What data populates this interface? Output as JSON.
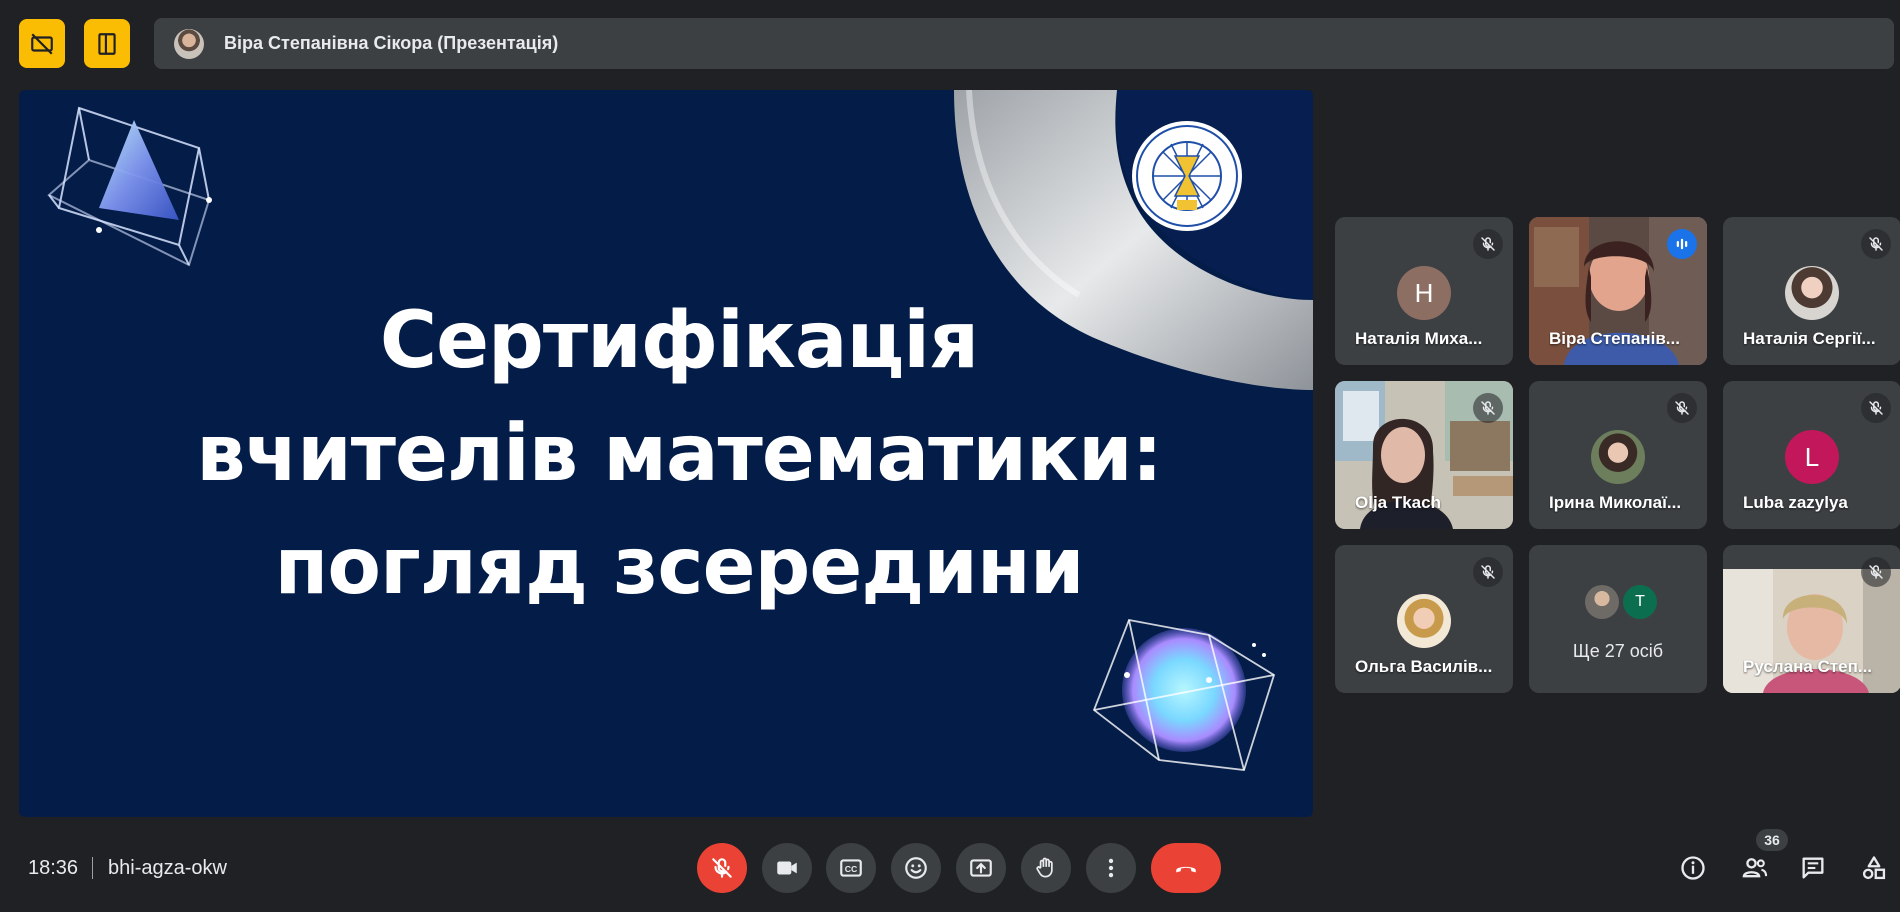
{
  "presentation_bar": {
    "presenter_name": "Віра Степанівна Сікора (Презентація)",
    "hide_tiles_icon": "hide-tiles-icon",
    "layout_icon": "layout-icon"
  },
  "slide": {
    "title_lines": [
      "Сертифікація",
      "вчителів математики:",
      "погляд зсередини"
    ],
    "background_color": "#031c48"
  },
  "participants": [
    {
      "name": "Наталія Миха...",
      "type": "initial",
      "initial": "Н",
      "avatar_color": "#8d6e63",
      "muted": true
    },
    {
      "name": "Віра Степанів...",
      "type": "video",
      "speaking": true,
      "muted": false
    },
    {
      "name": "Наталія Сергії...",
      "type": "photo",
      "muted": true
    },
    {
      "name": "Olja Tkach",
      "type": "video",
      "muted": true
    },
    {
      "name": "Ірина Миколаї...",
      "type": "photo",
      "muted": true
    },
    {
      "name": "Luba zazylya",
      "type": "initial",
      "initial": "L",
      "avatar_color": "#c2185b",
      "muted": true
    },
    {
      "name": "Ольга Василів...",
      "type": "photo",
      "muted": true
    },
    {
      "name": "Ще 27 осіб",
      "type": "more",
      "mini_initial": "T",
      "muted": false
    },
    {
      "name": "Руслана Степ...",
      "type": "video",
      "muted": true
    }
  ],
  "bottom_bar": {
    "time": "18:36",
    "meeting_code": "bhi-agza-okw",
    "people_count": "36",
    "accent_red": "#ea4335"
  }
}
